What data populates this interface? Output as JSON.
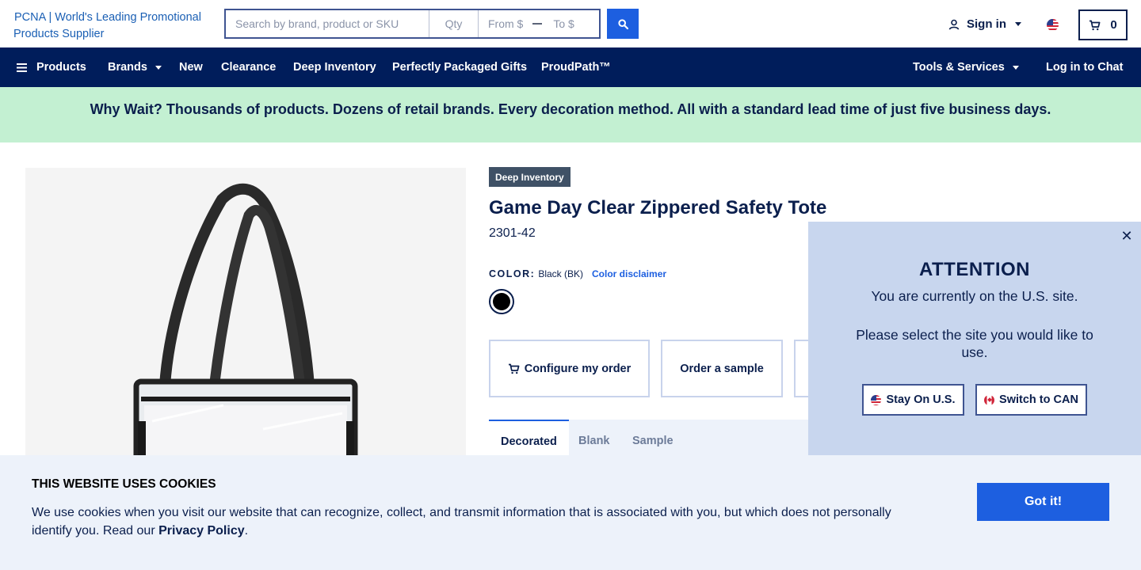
{
  "header": {
    "logo_alt": "PCNA | World's Leading Promotional Products Supplier",
    "search": {
      "placeholder": "Search by brand, product or SKU",
      "qty_placeholder": "Qty",
      "from_placeholder": "From $",
      "to_placeholder": "To $"
    },
    "signin_label": "Sign in",
    "cart_count": "0"
  },
  "nav": {
    "products": "Products",
    "brands": "Brands",
    "new": "New",
    "clearance": "Clearance",
    "deep_inventory": "Deep Inventory",
    "gifts": "Perfectly Packaged Gifts",
    "proudpath": "ProudPath™",
    "tools": "Tools & Services",
    "chat": "Log in to Chat"
  },
  "promo": "Why Wait? Thousands of products. Dozens of retail brands. Every decoration method. All with a standard lead time of just five business days.",
  "product": {
    "badge": "Deep Inventory",
    "title": "Game Day Clear Zippered Safety Tote",
    "sku": "2301-42",
    "color_label": "COLOR:",
    "color_value": "Black (BK)",
    "color_disclaimer": "Color disclaimer",
    "swatch_color": "#000000",
    "actions": {
      "configure": "Configure my order",
      "sample": "Order a sample"
    },
    "tabs": [
      "Decorated",
      "Blank",
      "Sample"
    ]
  },
  "attention": {
    "title": "ATTENTION",
    "line1": "You are currently on the U.S. site.",
    "line2": "Please select the site you would like to use.",
    "stay_us": "Stay On U.S.",
    "switch_can": "Switch to CAN"
  },
  "cookies": {
    "title": "THIS WEBSITE USES COOKIES",
    "text_before": "We use cookies when you visit our website that can recognize, collect, and transmit information that is associated with you, but which does not personally identify you. Read our ",
    "link": "Privacy Policy",
    "text_after": ".",
    "button": "Got it!"
  },
  "colors": {
    "navy": "#001d5b",
    "accent": "#1d5fe0",
    "promo_bg": "#c3f0d2",
    "panel_bg": "#c8d6ee",
    "cookie_bg": "#edf2fa"
  }
}
